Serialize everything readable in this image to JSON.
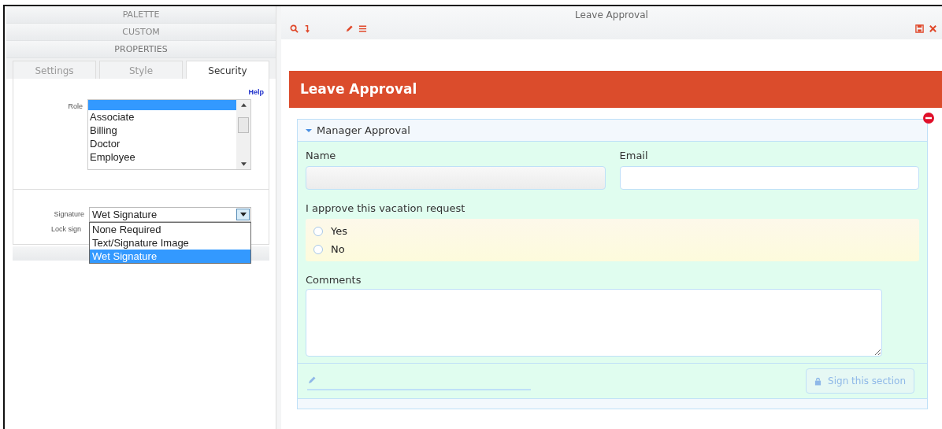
{
  "left_panel": {
    "accordion": [
      {
        "label": "PALETTE",
        "expanded": false
      },
      {
        "label": "CUSTOM",
        "expanded": false
      },
      {
        "label": "PROPERTIES",
        "expanded": true
      }
    ],
    "tabs": [
      {
        "label": "Settings",
        "selected": false
      },
      {
        "label": "Style",
        "selected": false
      },
      {
        "label": "Security",
        "selected": true
      }
    ],
    "help_link": "Help",
    "role": {
      "label": "Role",
      "blank_selected": true,
      "items": [
        {
          "label": "Associate",
          "selected": false
        },
        {
          "label": "Billing",
          "selected": false
        },
        {
          "label": "Doctor",
          "selected": false
        },
        {
          "label": "Employee",
          "selected": false
        }
      ]
    },
    "signature": {
      "label": "Signature",
      "value": "Wet Signature",
      "open": true,
      "options": [
        {
          "label": "None Required",
          "selected": false
        },
        {
          "label": "Text/Signature Image",
          "selected": false
        },
        {
          "label": "Wet Signature",
          "selected": true
        }
      ]
    },
    "lock_label": "Lock sign"
  },
  "editor": {
    "title": "Leave Approval",
    "form_title": "Leave Approval",
    "section": {
      "title": "Manager Approval",
      "expanded": true,
      "fields": [
        {
          "label": "Name",
          "disabled": true
        },
        {
          "label": "Email",
          "disabled": false
        }
      ],
      "question": "I approve this vacation request",
      "options": [
        {
          "label": "Yes",
          "selected": false
        },
        {
          "label": "No",
          "selected": false
        }
      ],
      "comments_label": "Comments",
      "sign_button": {
        "label": "Sign this section",
        "disabled": true
      }
    }
  }
}
